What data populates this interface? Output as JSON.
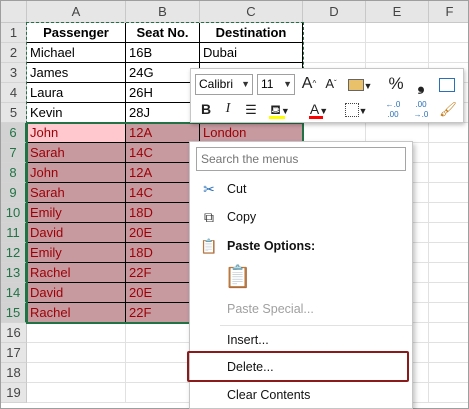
{
  "columns": [
    "A",
    "B",
    "C",
    "D",
    "E",
    "F"
  ],
  "rows": [
    "1",
    "2",
    "3",
    "4",
    "5",
    "6",
    "7",
    "8",
    "9",
    "10",
    "11",
    "12",
    "13",
    "14",
    "15",
    "16",
    "17",
    "18",
    "19"
  ],
  "table": {
    "headers": [
      "Passenger",
      "Seat No.",
      "Destination"
    ],
    "data": [
      [
        "Michael",
        "16B",
        "Dubai"
      ],
      [
        "James",
        "24G",
        ""
      ],
      [
        "Laura",
        "26H",
        ""
      ],
      [
        "Kevin",
        "28J",
        ""
      ],
      [
        "John",
        "12A",
        "London"
      ],
      [
        "Sarah",
        "14C",
        ""
      ],
      [
        "John",
        "12A",
        ""
      ],
      [
        "Sarah",
        "14C",
        ""
      ],
      [
        "Emily",
        "18D",
        ""
      ],
      [
        "David",
        "20E",
        ""
      ],
      [
        "Emily",
        "18D",
        ""
      ],
      [
        "Rachel",
        "22F",
        ""
      ],
      [
        "David",
        "20E",
        ""
      ],
      [
        "Rachel",
        "22F",
        ""
      ]
    ]
  },
  "mini_toolbar": {
    "font_name": "Calibri",
    "font_size": "11",
    "grow_font": "A",
    "shrink_font": "A",
    "percent": "%",
    "comma": "❟",
    "bold": "B",
    "italic": "I",
    "font_color_letter": "A",
    "increase_decimal": "←.0 .00",
    "decrease_decimal": ".00 →.0",
    "colors": {
      "fill": "#ffff00",
      "font": "#ff0000"
    }
  },
  "context_menu": {
    "search_placeholder": "Search the menus",
    "cut": "Cut",
    "copy": "Copy",
    "paste_options": "Paste Options:",
    "paste_special": "Paste Special...",
    "insert": "Insert...",
    "delete": "Delete...",
    "clear_contents": "Clear Contents"
  },
  "colors": {
    "selection": "#217346",
    "duplicate_fill": "#ffc7ce",
    "duplicate_text": "#9c0006",
    "highlight_box": "#8b1a1a"
  }
}
